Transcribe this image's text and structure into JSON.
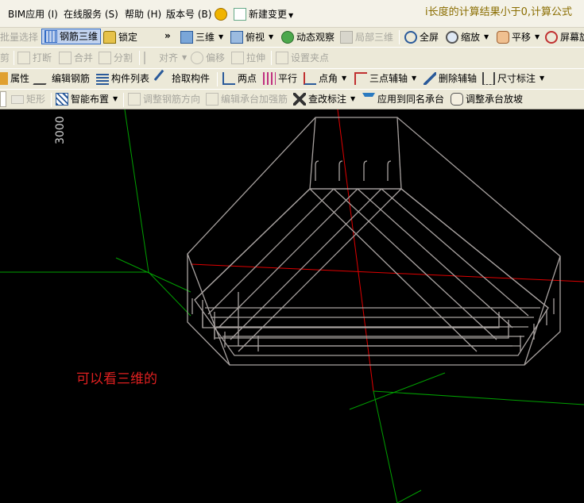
{
  "menubar": {
    "items": [
      "BIM应用 (I)",
      "在线服务 (S)",
      "帮助 (H)",
      "版本号 (B)",
      "新建变更"
    ],
    "warning": "i长度的计算结果小于0,计算公式"
  },
  "toolbar1": {
    "batch_select": "批量选择",
    "rebar_3d": "钢筋三维",
    "lock": "锁定",
    "more": "»",
    "three_d": "三维",
    "top_view": "俯视",
    "dynamic_view": "动态观察",
    "local_3d": "局部三维",
    "fullscreen": "全屏",
    "zoom": "缩放",
    "pan": "平移",
    "screen_rotate": "屏幕旋"
  },
  "toolbar2": {
    "items": [
      "剪",
      "打断",
      "合并",
      "分割",
      "对齐",
      "偏移",
      "拉伸",
      "设置夹点"
    ]
  },
  "toolbar3": {
    "properties": "属性",
    "edit_rebar": "编辑钢筋",
    "component_list": "构件列表",
    "pick_component": "拾取构件",
    "two_points": "两点",
    "parallel": "平行",
    "point_angle": "点角",
    "three_point_aux": "三点辅轴",
    "delete_aux": "删除辅轴",
    "dimension": "尺寸标注"
  },
  "toolbar4": {
    "rectangle": "矩形",
    "smart_layout": "智能布置",
    "adjust_rebar_dir": "调整钢筋方向",
    "edit_cap_rebar": "编辑承台加强筋",
    "check_annotation": "查改标注",
    "apply_same_cap": "应用到同名承台",
    "adjust_cap_slope": "调整承台放坡"
  },
  "viewport": {
    "dimension_label": "3000",
    "note": "可以看三维的"
  },
  "colors": {
    "toolbar_bg": "#ece9d8",
    "viewport_bg": "#000000",
    "axis_x": "#e00000",
    "axis_y": "#00a000",
    "wire": "#a8a2a0",
    "note": "#e02020"
  }
}
